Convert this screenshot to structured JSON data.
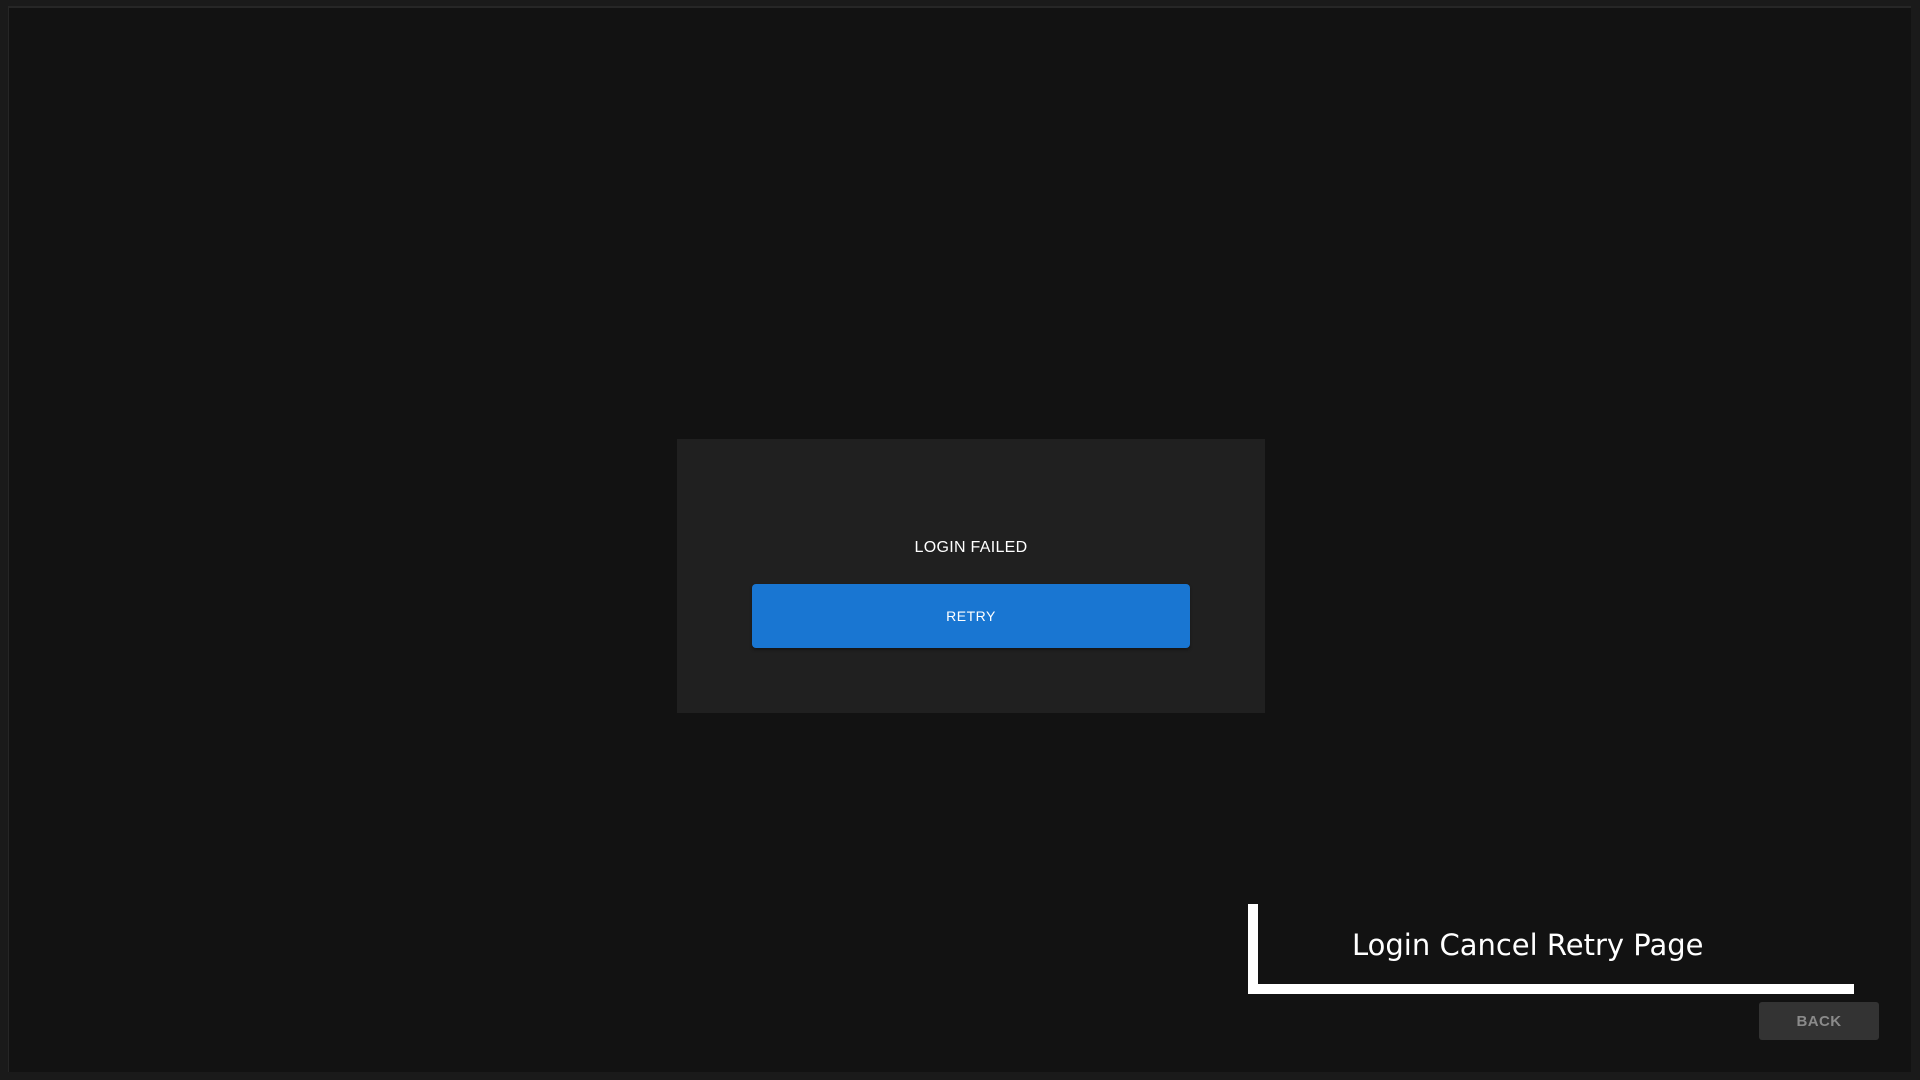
{
  "dialog": {
    "title": "LOGIN FAILED",
    "retry_label": "RETRY"
  },
  "annotation": {
    "label": "Login Cancel Retry Page"
  },
  "footer": {
    "back_label": "BACK"
  },
  "colors": {
    "background": "#121212",
    "dialog_background": "#202020",
    "primary_button": "#1976d2",
    "back_button": "#333333",
    "annotation": "#ffffff"
  }
}
